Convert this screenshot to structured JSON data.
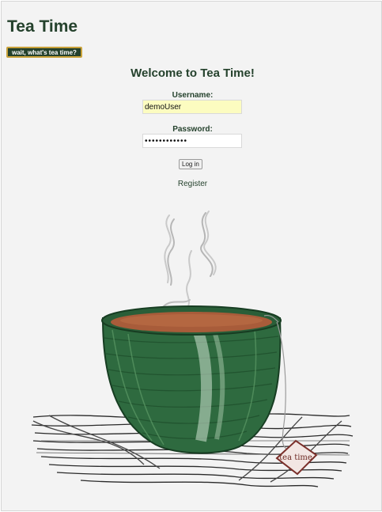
{
  "app": {
    "title": "Tea Time"
  },
  "about": {
    "label": "wait, what's tea time?"
  },
  "login": {
    "heading": "Welcome to Tea Time!",
    "username_label": "Username:",
    "username_value": "demoUser",
    "password_label": "Password:",
    "password_masked": "••••••••••••",
    "submit_label": "Log in",
    "register_label": "Register"
  },
  "illustration": {
    "tag_text": "tea time",
    "icon": "tea-cup-illustration"
  },
  "colors": {
    "brand_green": "#24412c",
    "accent_gold": "#c9a23a",
    "cup_green": "#2e6a3f",
    "tea_brown": "#a85c3a",
    "background": "#f3f3f3",
    "username_fill": "#fcfcc0"
  }
}
